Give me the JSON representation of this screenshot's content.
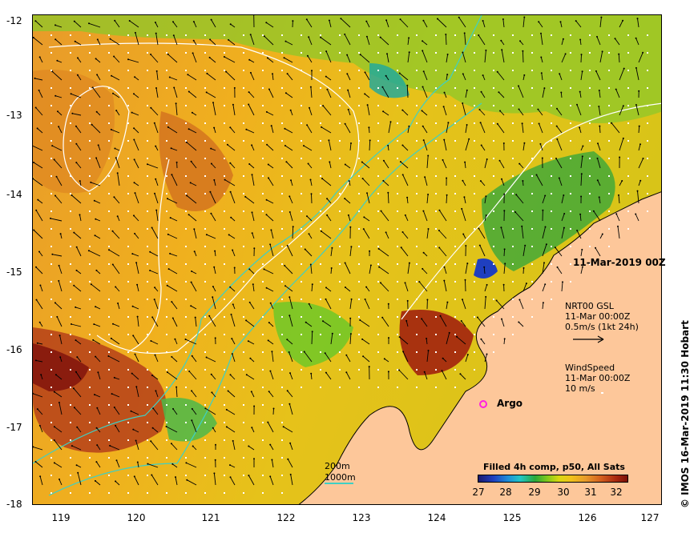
{
  "map": {
    "date_label": "11-Mar-2019 00Z",
    "y_ticks": [
      "-12",
      "-13",
      "-14",
      "-15",
      "-16",
      "-17",
      "-18"
    ],
    "x_ticks": [
      "119",
      "120",
      "121",
      "122",
      "123",
      "124",
      "125",
      "126",
      "127"
    ],
    "current_legend": {
      "line1": "NRT00 GSL",
      "line2": "11-Mar 00:00Z",
      "line3": "0.5m/s (1kt 24h)"
    },
    "wind_legend": {
      "line1": "WindSpeed",
      "line2": "11-Mar 00:00Z",
      "line3": "10 m/s"
    },
    "argo_label": "Argo",
    "isobath_legend": {
      "line1": "200m",
      "line2": "1000m"
    },
    "colorbar": {
      "title": "Filled 4h comp, p50, All Sats",
      "ticks": [
        "27",
        "28",
        "29",
        "30",
        "31",
        "32"
      ]
    },
    "credit": "© IMOS 16-Mar-2019 11:30 Hobart"
  },
  "colors": {
    "land": "#fdc79a",
    "isobath": "#3ed0c4",
    "contour": "#ffffff",
    "argo": "#ff20e0"
  }
}
